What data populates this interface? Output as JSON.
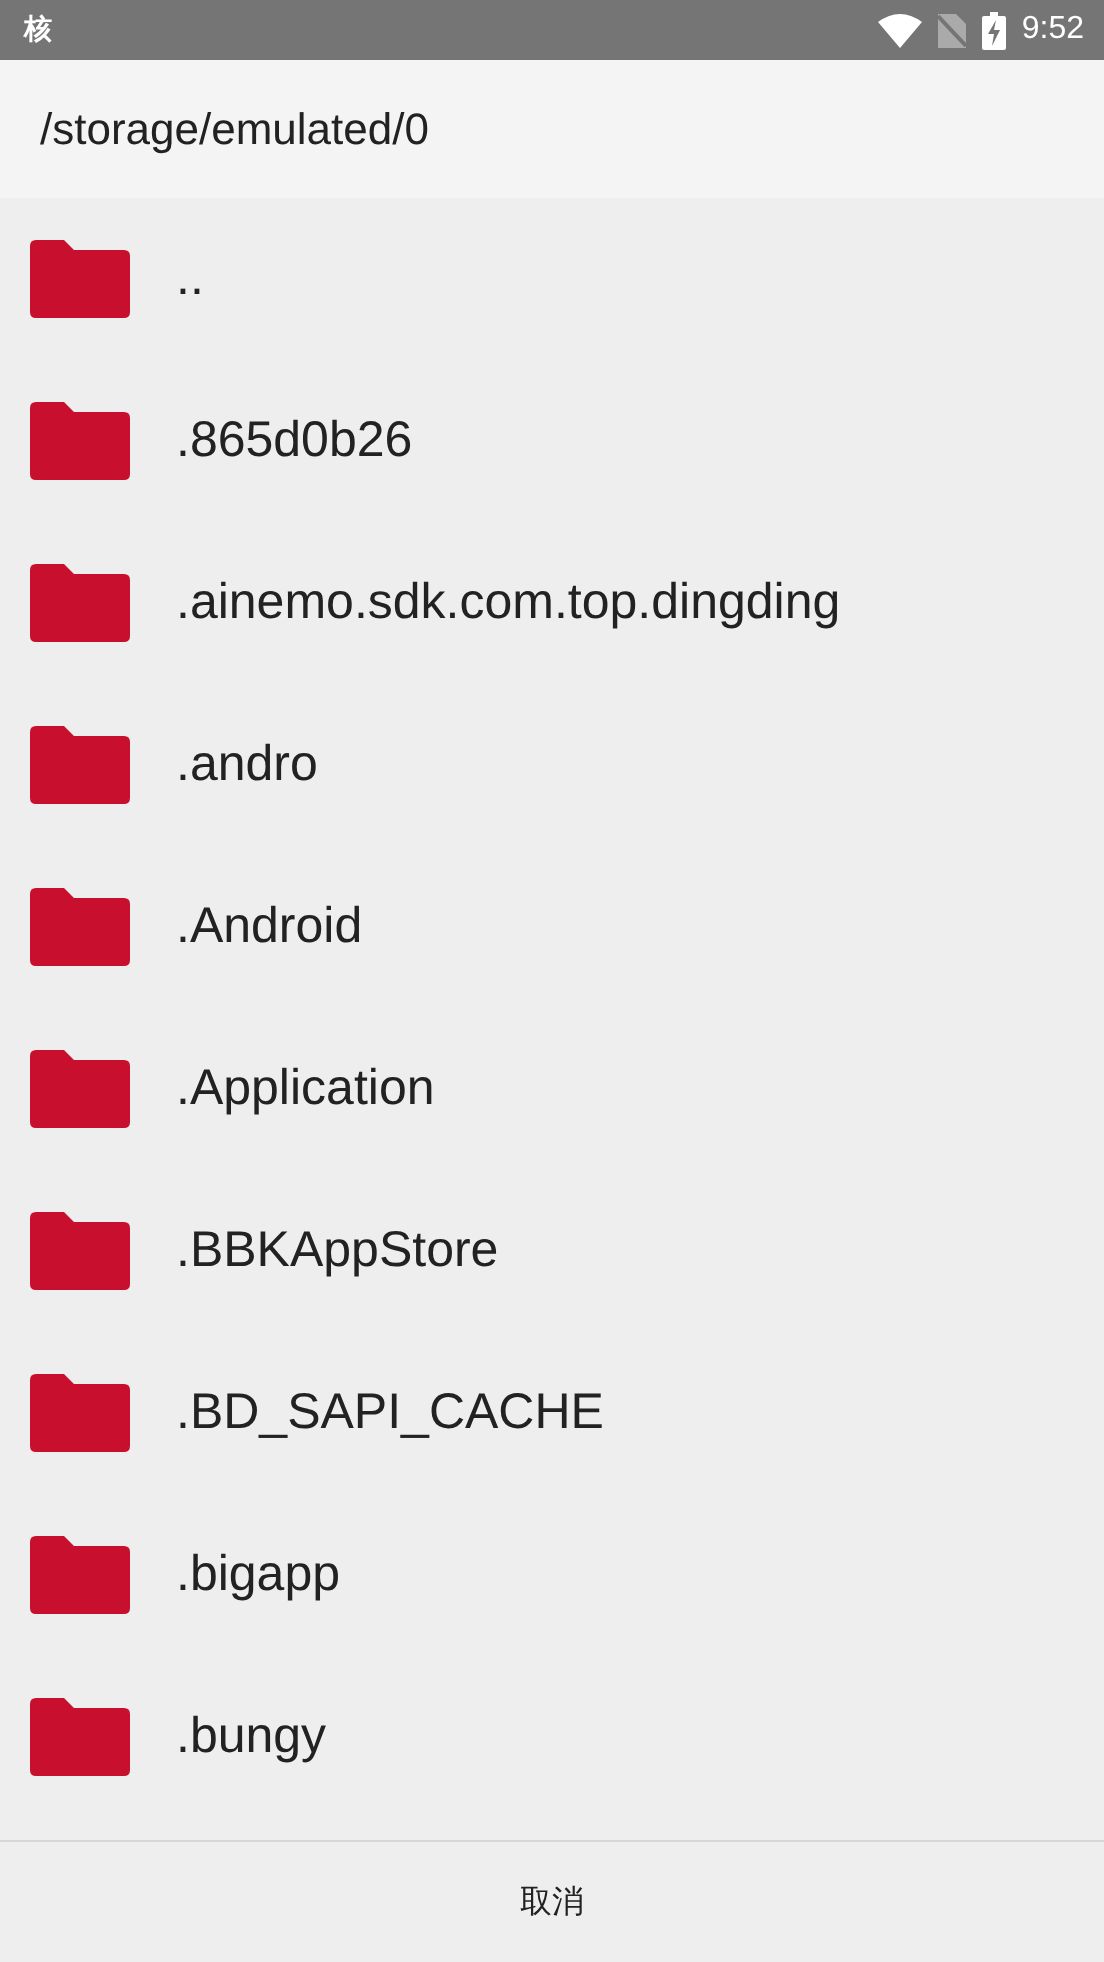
{
  "status_bar": {
    "app_label": "核",
    "time": "9:52"
  },
  "header": {
    "path": "/storage/emulated/0"
  },
  "folders": [
    {
      "name": ".."
    },
    {
      "name": ".865d0b26"
    },
    {
      "name": ".ainemo.sdk.com.top.dingding"
    },
    {
      "name": ".andro"
    },
    {
      "name": ".Android"
    },
    {
      "name": ".Application"
    },
    {
      "name": ".BBKAppStore"
    },
    {
      "name": ".BD_SAPI_CACHE"
    },
    {
      "name": ".bigapp"
    },
    {
      "name": ".bungy"
    }
  ],
  "footer": {
    "cancel": "取消"
  }
}
